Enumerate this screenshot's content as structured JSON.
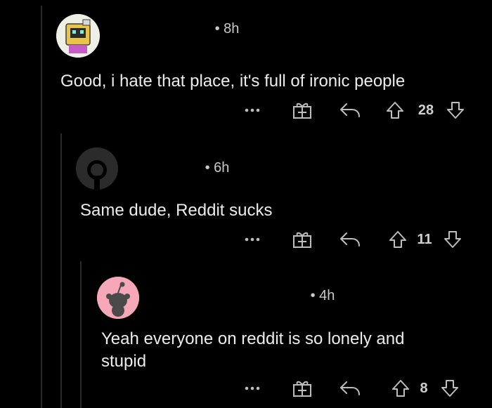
{
  "comments": [
    {
      "username": "",
      "time": "8h",
      "body": "Good, i hate that place, it's full of ironic people",
      "votes": "28",
      "avatar": "robot-box-avatar"
    },
    {
      "username": "",
      "time": "6h",
      "body": "Same dude, Reddit sucks",
      "votes": "11",
      "avatar": "default-snoo-avatar"
    },
    {
      "username": "",
      "time": "4h",
      "body": "Yeah everyone on reddit is so lonely and stupid",
      "votes": "8",
      "avatar": "pink-snoo-avatar"
    }
  ],
  "separator": "•",
  "icons": {
    "more": "more-options-icon",
    "award": "award-icon",
    "reply": "reply-icon",
    "upvote": "upvote-arrow-icon",
    "downvote": "downvote-arrow-icon"
  },
  "colors": {
    "background": "#000000",
    "text": "#ececec",
    "meta": "#c9c9c9",
    "thread_line": "#2a2a2a",
    "avatar_pink": "#f7a8b8"
  }
}
